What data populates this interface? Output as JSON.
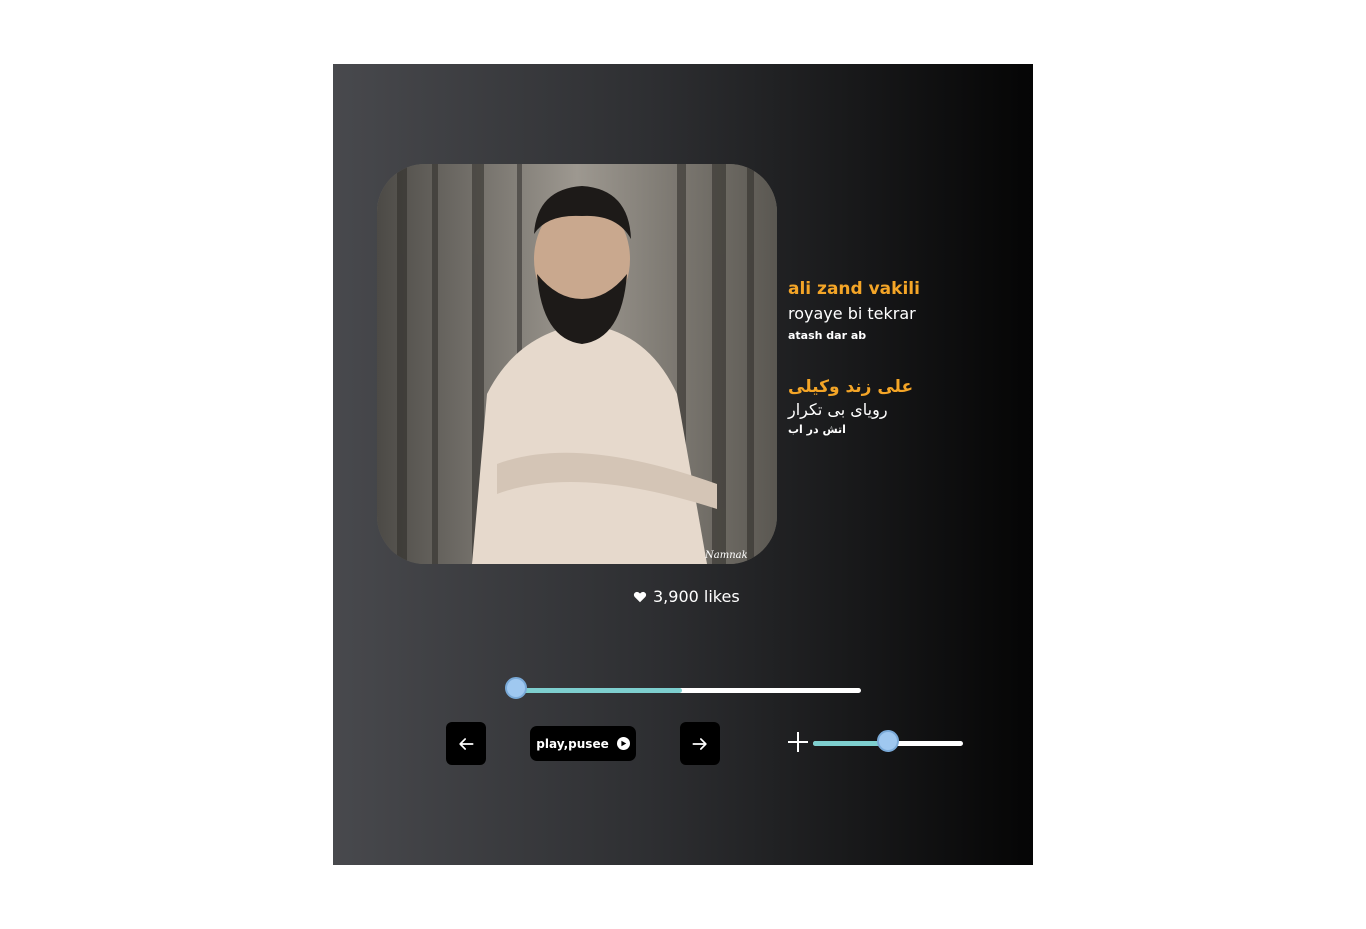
{
  "player": {
    "artist_en": "ali zand vakili",
    "song_en": "royaye bi tekrar",
    "album_en": "atash dar ab",
    "artist_fa": "علی زند وکیلی",
    "song_fa": "رویای بی تکرار",
    "album_fa": "اتش در اب",
    "likes_label": "3,900 likes",
    "cover_watermark": "Namnak",
    "progress": 0.48,
    "volume": 0.5
  },
  "controls": {
    "play_label": "play,pusee",
    "prev_icon": "arrow-left-icon",
    "next_icon": "arrow-right-icon",
    "play_icon": "play-circle-icon",
    "volume_icon": "plus-icon",
    "like_icon": "heart-icon"
  },
  "colors": {
    "accent": "#f4a527",
    "slider_fill": "#7ecfcf",
    "slider_thumb": "#9fc8f0"
  }
}
